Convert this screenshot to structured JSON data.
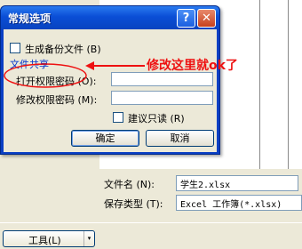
{
  "dialog": {
    "title": "常规选项",
    "help_icon": "?",
    "close_icon": "✕",
    "backup_label": "生成备份文件 (B)",
    "file_share_label": "文件共享",
    "open_password_label": "打开权限密码 (O):",
    "open_password_value": "",
    "modify_password_label": "修改权限密码 (M):",
    "modify_password_value": "",
    "readonly_label": "建议只读 (R)",
    "ok_label": "确定",
    "cancel_label": "取消"
  },
  "annotation": {
    "text": "修改这里就ok了",
    "color": "#ee1111"
  },
  "save_dialog": {
    "filename_label": "文件名 (N):",
    "filename_value": "学生2.xlsx",
    "filetype_label": "保存类型 (T):",
    "filetype_value": "Excel 工作簿(*.xlsx)",
    "tools_label": "工具(L)",
    "tools_arrow": "▾"
  },
  "colors": {
    "titlebar": "#0a4ed6",
    "dialog_face": "#ece9d8",
    "link": "#0033cc",
    "close_button": "#c8401e"
  }
}
